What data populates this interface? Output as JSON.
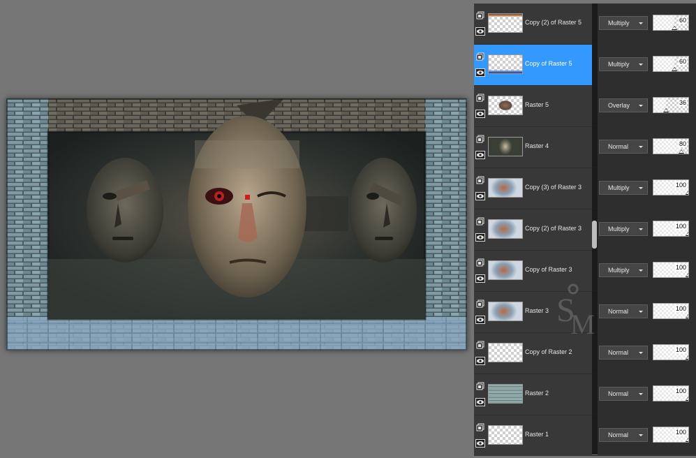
{
  "workspace": {
    "background": "#767676"
  },
  "layers_panel": {
    "selected_color": "#3399ff",
    "layers": [
      {
        "name": "Copy (2) of Raster 5",
        "blend": "Multiply",
        "opacity": 60,
        "visible": true,
        "selected": false,
        "thumb": "top-strip"
      },
      {
        "name": "Copy of Raster 5",
        "blend": "Multiply",
        "opacity": 60,
        "visible": true,
        "selected": true,
        "thumb": "bottom-strip"
      },
      {
        "name": "Raster 5",
        "blend": "Overlay",
        "opacity": 36,
        "visible": true,
        "selected": false,
        "thumb": "small-scene"
      },
      {
        "name": "Raster 4",
        "blend": "Normal",
        "opacity": 80,
        "visible": true,
        "selected": false,
        "thumb": "faces"
      },
      {
        "name": "Copy (3) of Raster 3",
        "blend": "Multiply",
        "opacity": 100,
        "visible": true,
        "selected": false,
        "thumb": "warm-center"
      },
      {
        "name": "Copy (2) of Raster 3",
        "blend": "Multiply",
        "opacity": 100,
        "visible": true,
        "selected": false,
        "thumb": "warm-center"
      },
      {
        "name": "Copy of Raster 3",
        "blend": "Multiply",
        "opacity": 100,
        "visible": true,
        "selected": false,
        "thumb": "warm-center"
      },
      {
        "name": "Raster 3",
        "blend": "Normal",
        "opacity": 100,
        "visible": true,
        "selected": false,
        "thumb": "warm-center"
      },
      {
        "name": "Copy of Raster 2",
        "blend": "Normal",
        "opacity": 100,
        "visible": true,
        "selected": false,
        "thumb": "empty"
      },
      {
        "name": "Raster 2",
        "blend": "Normal",
        "opacity": 100,
        "visible": true,
        "selected": false,
        "thumb": "texture"
      },
      {
        "name": "Raster 1",
        "blend": "Normal",
        "opacity": 100,
        "visible": true,
        "selected": false,
        "thumb": "empty"
      }
    ]
  },
  "icons": {
    "group": "layer-group-icon",
    "visibility": "eye-icon",
    "dropdown": "chevron-down-icon"
  }
}
